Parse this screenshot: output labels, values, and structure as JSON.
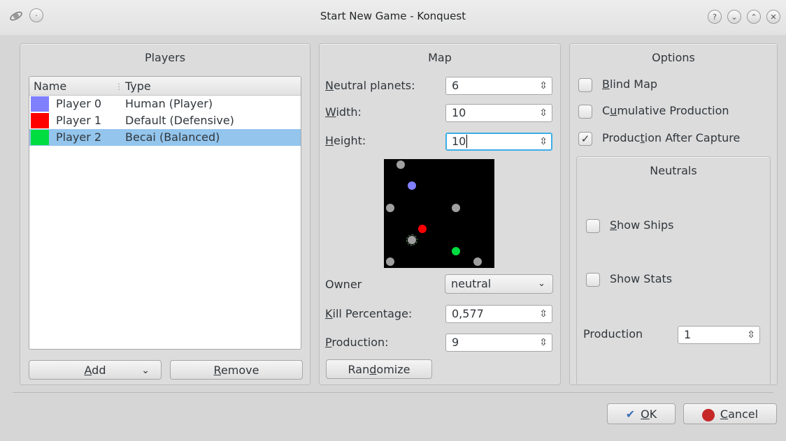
{
  "window": {
    "title": "Start New Game - Konquest",
    "icons": [
      "app-icon",
      "menu-icon"
    ],
    "controls": [
      "help-icon",
      "minimize-icon",
      "maximize-icon",
      "close-icon"
    ],
    "control_glyphs": {
      "help": "?",
      "minimize": "⌄",
      "maximize": "⌃",
      "close": "✕",
      "menu": "·"
    }
  },
  "players": {
    "title": "Players",
    "columns": {
      "name": "Name",
      "type": "Type"
    },
    "rows": [
      {
        "name": "Player 0",
        "type": "Human (Player)",
        "color": "#8080ff"
      },
      {
        "name": "Player 1",
        "type": "Default (Defensive)",
        "color": "#ff0000"
      },
      {
        "name": "Player 2",
        "type": "Becai (Balanced)",
        "color": "#00dd40"
      }
    ],
    "add_label_u": "A",
    "add_label_rest": "dd",
    "remove_label_u": "R",
    "remove_label_rest": "emove",
    "chevron": "⌄"
  },
  "map": {
    "title": "Map",
    "neutral_planets": {
      "label_u": "N",
      "label_rest": "eutral planets:",
      "value": "6"
    },
    "width": {
      "label_u": "W",
      "label_rest": "idth:",
      "value": "10"
    },
    "height": {
      "label_u": "H",
      "label_rest": "eight:",
      "value": "10"
    },
    "owner": {
      "label": "Owner",
      "value": "neutral"
    },
    "kill_percentage": {
      "label_u": "K",
      "label_rest": "ill Percentage:",
      "value": "0,577"
    },
    "production": {
      "label_u": "P",
      "label_rest": "roduction:",
      "value": "9"
    },
    "randomize_pre": "Ran",
    "randomize_u": "d",
    "randomize_post": "omize",
    "spin_glyph": "⇳",
    "combo_glyph": "⌄",
    "colors": {
      "background": "#000000",
      "neutral": "#a0a0a0",
      "player0": "#8080ff",
      "player1": "#ff0000",
      "player2": "#00dd40"
    }
  },
  "options": {
    "title": "Options",
    "blind_map": {
      "label_u": "B",
      "label_rest": "lind Map",
      "checked": false
    },
    "cumulative": {
      "label_pre": "C",
      "label_u": "u",
      "label_rest": "mulative Production",
      "checked": false
    },
    "after_capture": {
      "label_pre": "Produc",
      "label_u": "t",
      "label_rest": "ion After Capture",
      "checked": true,
      "check_glyph": "✓"
    },
    "neutrals": {
      "title": "Neutrals",
      "show_ships": {
        "label_u": "S",
        "label_rest": "how Ships",
        "checked": false
      },
      "show_stats": {
        "label": "Show Stats",
        "checked": false
      },
      "production_label": "Production",
      "production_value": "1"
    }
  },
  "footer": {
    "ok_label_u": "O",
    "ok_label_rest": "K",
    "ok_icon": "✔",
    "cancel_label_u": "C",
    "cancel_label_rest": "ancel",
    "cancel_icon": "⊘"
  }
}
